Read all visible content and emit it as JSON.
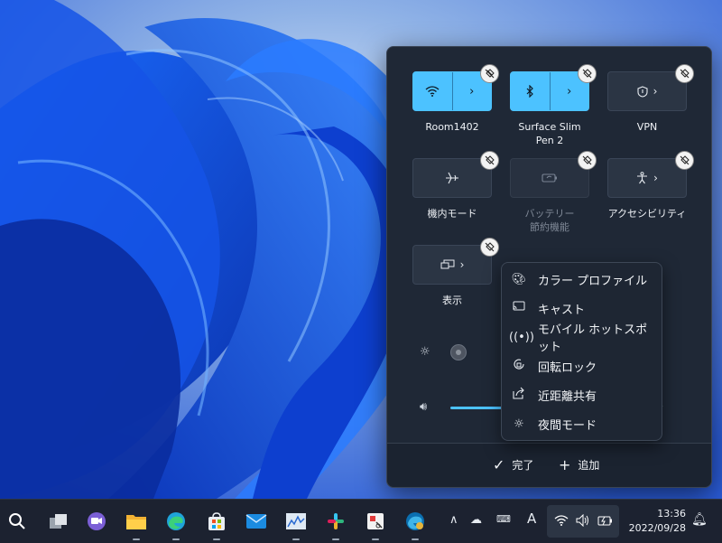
{
  "colors": {
    "accent": "#4cc2ff",
    "panel": "#1f2836",
    "taskbar": "#1c2230",
    "wallpaper": "#1a56e8"
  },
  "quick_settings": {
    "tiles": [
      {
        "label": "Room1402",
        "icon": "wifi-icon",
        "state": "active",
        "type": "split"
      },
      {
        "label": "Surface Slim Pen 2",
        "icon": "bluetooth-icon",
        "state": "active",
        "type": "split"
      },
      {
        "label": "VPN",
        "icon": "shield-icon",
        "state": "off",
        "type": "chevron"
      },
      {
        "label": "機内モード",
        "icon": "airplane-icon",
        "state": "off",
        "type": "plain"
      },
      {
        "label": "バッテリー 節約機能",
        "label_line1": "バッテリー",
        "label_line2": "節約機能",
        "icon": "battery-saver-icon",
        "state": "disabled",
        "type": "plain"
      },
      {
        "label": "アクセシビリティ",
        "icon": "accessibility-icon",
        "state": "off",
        "type": "chevron"
      },
      {
        "label": "表示",
        "icon": "cast-display-icon",
        "state": "off",
        "type": "chevron"
      }
    ],
    "brightness": {
      "icon": "brightness-icon",
      "value_percent": 0
    },
    "volume": {
      "icon": "volume-icon",
      "value_percent": 55
    },
    "footer": {
      "done_label": "完了",
      "add_label": "追加"
    }
  },
  "add_menu": {
    "items": [
      {
        "label": "カラー プロファイル",
        "icon": "palette-icon"
      },
      {
        "label": "キャスト",
        "icon": "cast-icon"
      },
      {
        "label": "モバイル ホットスポット",
        "icon": "hotspot-icon"
      },
      {
        "label": "回転ロック",
        "icon": "rotation-lock-icon"
      },
      {
        "label": "近距離共有",
        "icon": "nearby-share-icon"
      },
      {
        "label": "夜間モード",
        "icon": "night-light-icon"
      }
    ]
  },
  "taskbar": {
    "apps": [
      "search-icon",
      "task-view-icon",
      "teams-chat-icon",
      "file-explorer-icon",
      "edge-icon",
      "store-icon",
      "mail-icon",
      "performance-monitor-icon",
      "slack-icon",
      "snipping-tool-icon",
      "edge-beta-icon"
    ],
    "tray_ime": "A",
    "clock": {
      "time": "13:36",
      "date": "2022/09/28"
    }
  }
}
